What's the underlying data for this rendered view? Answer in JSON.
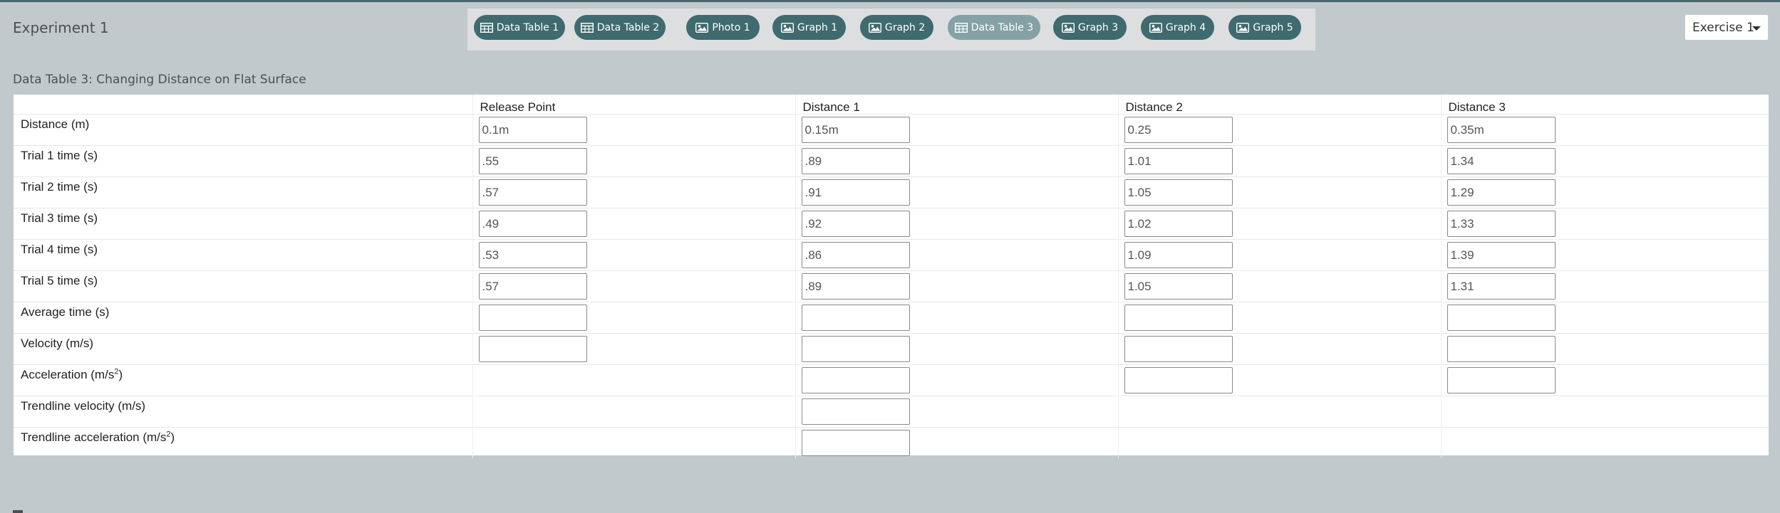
{
  "app": {
    "title": "Experiment 1"
  },
  "tabs": [
    {
      "label": "Data Table 1",
      "icon": "table-icon",
      "active": false
    },
    {
      "label": "Data Table 2",
      "icon": "table-icon",
      "active": false
    },
    {
      "label": "Photo 1",
      "icon": "image-icon",
      "active": false
    },
    {
      "label": "Graph 1",
      "icon": "image-icon",
      "active": false
    },
    {
      "label": "Graph 2",
      "icon": "image-icon",
      "active": false
    },
    {
      "label": "Data Table 3",
      "icon": "table-icon",
      "active": true
    },
    {
      "label": "Graph 3",
      "icon": "image-icon",
      "active": false
    },
    {
      "label": "Graph 4",
      "icon": "image-icon",
      "active": false
    },
    {
      "label": "Graph 5",
      "icon": "image-icon",
      "active": false
    }
  ],
  "exercise_select": {
    "value": "Exercise 1"
  },
  "section": {
    "title": "Data Table 3: Changing Distance on Flat Surface"
  },
  "table": {
    "columns": [
      "",
      "Release Point",
      "Distance 1",
      "Distance 2",
      "Distance 3"
    ],
    "rows": [
      {
        "label": "Distance (m)",
        "sup": "",
        "label_end": "",
        "cells": [
          "0.1m",
          "0.15m",
          "0.25",
          "0.35m"
        ],
        "inputs": [
          true,
          true,
          true,
          true
        ]
      },
      {
        "label": "Trial 1 time (s)",
        "sup": "",
        "label_end": "",
        "cells": [
          ".55",
          ".89",
          "1.01",
          "1.34"
        ],
        "inputs": [
          true,
          true,
          true,
          true
        ]
      },
      {
        "label": "Trial 2 time (s)",
        "sup": "",
        "label_end": "",
        "cells": [
          ".57",
          ".91",
          "1.05",
          "1.29"
        ],
        "inputs": [
          true,
          true,
          true,
          true
        ]
      },
      {
        "label": "Trial 3 time (s)",
        "sup": "",
        "label_end": "",
        "cells": [
          ".49",
          ".92",
          "1.02",
          "1.33"
        ],
        "inputs": [
          true,
          true,
          true,
          true
        ]
      },
      {
        "label": "Trial 4 time (s)",
        "sup": "",
        "label_end": "",
        "cells": [
          ".53",
          ".86",
          "1.09",
          "1.39"
        ],
        "inputs": [
          true,
          true,
          true,
          true
        ]
      },
      {
        "label": "Trial 5 time (s)",
        "sup": "",
        "label_end": "",
        "cells": [
          ".57",
          ".89",
          "1.05",
          "1.31"
        ],
        "inputs": [
          true,
          true,
          true,
          true
        ]
      },
      {
        "label": "Average time (s)",
        "sup": "",
        "label_end": "",
        "cells": [
          "",
          "",
          "",
          ""
        ],
        "inputs": [
          true,
          true,
          true,
          true
        ]
      },
      {
        "label": "Velocity (m/s)",
        "sup": "",
        "label_end": "",
        "cells": [
          "",
          "",
          "",
          ""
        ],
        "inputs": [
          true,
          true,
          true,
          true
        ]
      },
      {
        "label": "Acceleration (m/s",
        "sup": "2",
        "label_end": ")",
        "cells": [
          "",
          "",
          "",
          ""
        ],
        "inputs": [
          false,
          true,
          true,
          true
        ]
      },
      {
        "label": "Trendline velocity (m/s)",
        "sup": "",
        "label_end": "",
        "cells": [
          "",
          "",
          "",
          ""
        ],
        "inputs": [
          false,
          true,
          false,
          false
        ]
      },
      {
        "label": "Trendline acceleration (m/s",
        "sup": "2",
        "label_end": ")",
        "cells": [
          "",
          "",
          "",
          ""
        ],
        "inputs": [
          false,
          true,
          false,
          false
        ]
      }
    ]
  },
  "colors": {
    "background": "#c2c9cc",
    "tab": "#3f6a6f",
    "tab_active": "#84a2a6",
    "tab_bar": "#dcdedf",
    "top_line": "#4a666c"
  }
}
